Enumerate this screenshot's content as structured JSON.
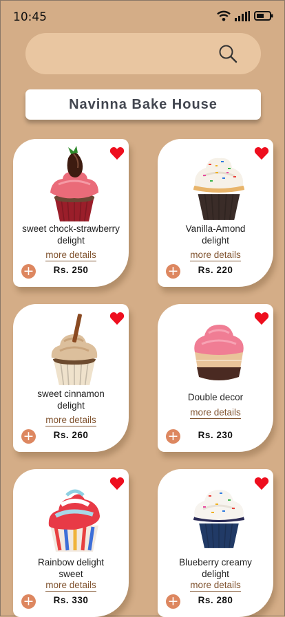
{
  "status_bar": {
    "time": "10:45",
    "icons": [
      "wifi-icon",
      "signal-icon",
      "battery-icon"
    ]
  },
  "search": {
    "value": "",
    "placeholder": ""
  },
  "header": {
    "title": "Navinna Bake House"
  },
  "colors": {
    "background": "#d4ad87",
    "search_bar": "#e9c6a1",
    "heart": "#ee0e1e",
    "add_button": "#dd8760",
    "more_link": "#80532f"
  },
  "products": [
    {
      "name_line1": "sweet chock-strawberry",
      "name_line2": "delight",
      "more": "more details",
      "price": "Rs. 250",
      "favorite_icon": "heart-icon",
      "add_icon": "plus-icon"
    },
    {
      "name_line1": "Vanilla-Amond",
      "name_line2": "delight",
      "more": "more details",
      "price": "Rs. 220",
      "favorite_icon": "heart-icon",
      "add_icon": "plus-icon"
    },
    {
      "name_line1": "sweet cinnamon",
      "name_line2": "delight",
      "more": "more details",
      "price": "Rs. 260",
      "favorite_icon": "heart-icon",
      "add_icon": "plus-icon"
    },
    {
      "name_line1": "Double decor",
      "name_line2": "",
      "more": "more details",
      "price": "Rs. 230",
      "favorite_icon": "heart-icon",
      "add_icon": "plus-icon"
    },
    {
      "name_line1": "Rainbow delight",
      "name_line2": "sweet",
      "more": "more details",
      "price": "Rs. 330",
      "favorite_icon": "heart-icon",
      "add_icon": "plus-icon"
    },
    {
      "name_line1": "Blueberry creamy",
      "name_line2": "delight",
      "more": "more details",
      "price": "Rs. 280",
      "favorite_icon": "heart-icon",
      "add_icon": "plus-icon"
    }
  ]
}
